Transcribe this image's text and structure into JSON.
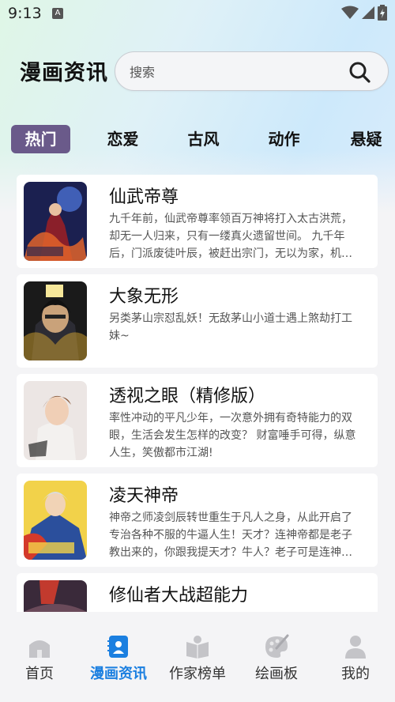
{
  "status": {
    "time": "9:13",
    "notif": "A"
  },
  "header": {
    "title": "漫画资讯"
  },
  "search": {
    "placeholder": "搜索"
  },
  "tabs": [
    {
      "label": "热门"
    },
    {
      "label": "恋爱"
    },
    {
      "label": "古风"
    },
    {
      "label": "动作"
    },
    {
      "label": "悬疑"
    }
  ],
  "items": [
    {
      "title": "仙武帝尊",
      "desc": "九千年前，仙武帝尊率领百万神将打入太古洪荒，却无一人归来，只有一缕真火遗留世间。 九千年后，门派废徒叶辰，被赶出宗门，无以为家，机…",
      "thumb_text": "仙武帝尊"
    },
    {
      "title": "大象无形",
      "desc": "另类茅山宗怼乱妖！无敌茅山小道士遇上煞劫打工妹~",
      "thumb_text": "大象无形"
    },
    {
      "title": "透视之眼（精修版）",
      "desc": "率性冲动的平凡少年，一次意外拥有奇特能力的双眼，生活会发生怎样的改变？ 财富唾手可得，纵意人生，笑傲都市江湖!",
      "thumb_text": "透视之眼"
    },
    {
      "title": "凌天神帝",
      "desc": "神帝之师凌剑辰转世重生于凡人之身，从此开启了专治各种不服的牛逼人生！天才？连神帝都是老子教出来的，你跟我提天才？牛人？老子可是连神…",
      "thumb_text": "凌天神帝"
    },
    {
      "title": "修仙者大战超能力",
      "desc": "",
      "thumb_text": "修"
    }
  ],
  "nav": [
    {
      "label": "首页",
      "icon": "home-icon"
    },
    {
      "label": "漫画资讯",
      "icon": "news-icon"
    },
    {
      "label": "作家榜单",
      "icon": "book-icon"
    },
    {
      "label": "绘画板",
      "icon": "palette-icon"
    },
    {
      "label": "我的",
      "icon": "user-icon"
    }
  ],
  "colors": {
    "accent": "#1b7fe0",
    "tab_active": "#6a5a8a"
  }
}
